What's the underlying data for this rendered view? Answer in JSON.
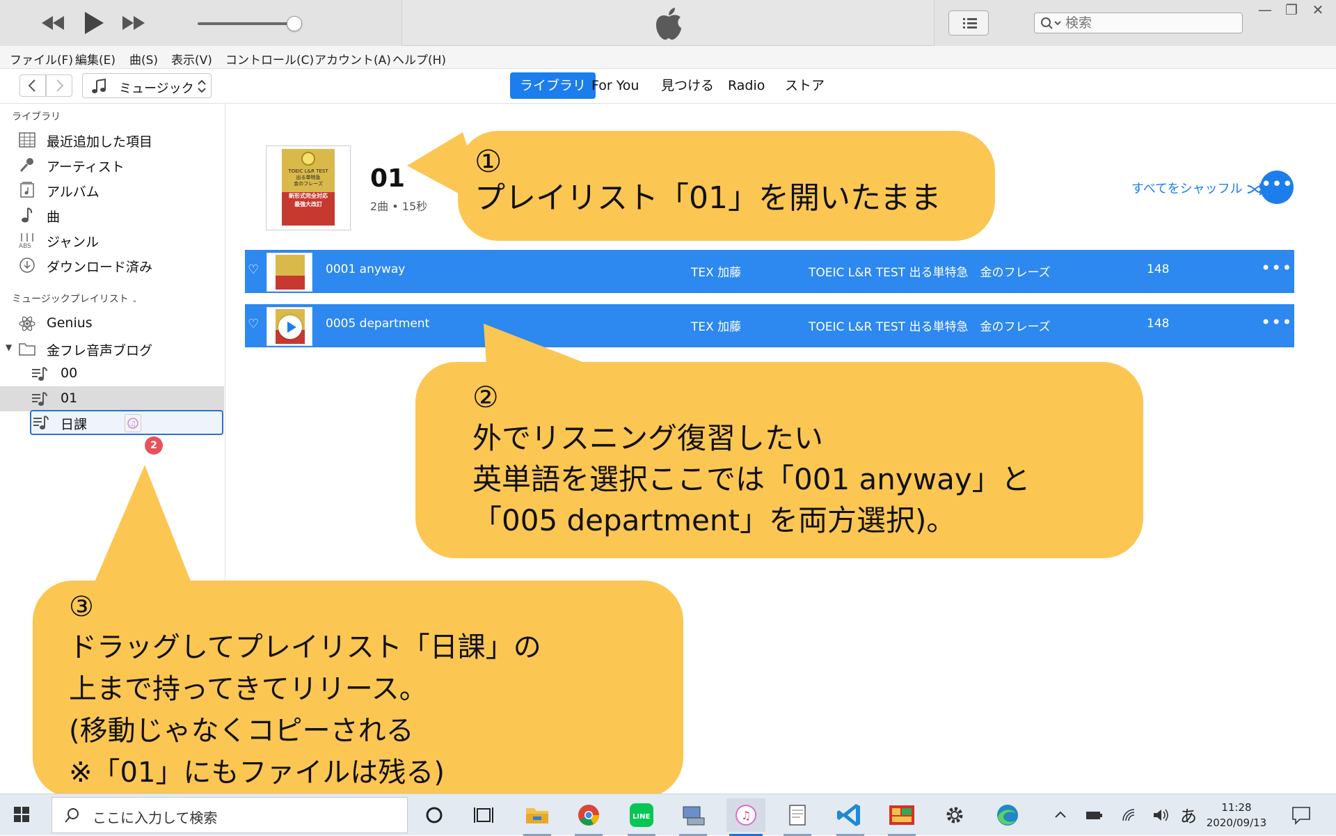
{
  "window": {
    "search_placeholder": "検索",
    "apple_logo": "apple-logo",
    "minimize": "—",
    "restore": "❐",
    "close": "✕"
  },
  "menu": {
    "items": [
      "ファイル(F)",
      "編集(E)",
      "曲(S)",
      "表示(V)",
      "コントロール(C)",
      "アカウント(A)",
      "ヘルプ(H)"
    ]
  },
  "nav": {
    "media_kind": "ミュージック",
    "tabs": [
      {
        "label": "ライブラリ",
        "active": true
      },
      {
        "label": "For You",
        "active": false
      },
      {
        "label": "見つける",
        "active": false
      },
      {
        "label": "Radio",
        "active": false
      },
      {
        "label": "ストア",
        "active": false
      }
    ]
  },
  "sidebar": {
    "library_heading": "ライブラリ",
    "library_items": [
      {
        "label": "最近追加した項目",
        "icon": "grid-calendar-icon"
      },
      {
        "label": "アーティスト",
        "icon": "microphone-icon"
      },
      {
        "label": "アルバム",
        "icon": "album-icon"
      },
      {
        "label": "曲",
        "icon": "music-note-icon"
      },
      {
        "label": "ジャンル",
        "icon": "genre-icon"
      },
      {
        "label": "ダウンロード済み",
        "icon": "download-icon"
      }
    ],
    "playlists_heading": "ミュージックプレイリスト",
    "genius": "Genius",
    "folder": "金フレ音声ブログ",
    "playlists": [
      "00",
      "01",
      "日課"
    ],
    "selected_playlist": "01",
    "drop_target": "日課",
    "drag_count": "2"
  },
  "playlist": {
    "title": "01",
    "meta": "2曲 • 15秒",
    "shuffle_label": "すべてをシャッフル",
    "more": "•••",
    "cover_lines": [
      "TOEIC L&R TEST",
      "出る単特急",
      "金のフレーズ",
      "新形式完全対応",
      "最強大改訂"
    ]
  },
  "tracks": [
    {
      "title": "0001 anyway",
      "artist": "TEX 加藤",
      "album": "TOEIC L&R TEST 出る単特急　金のフレーズ",
      "count": "148",
      "heart": "♡",
      "more": "•••"
    },
    {
      "title": "0005 department",
      "artist": "TEX 加藤",
      "album": "TOEIC L&R TEST 出る単特急　金のフレーズ",
      "count": "148",
      "heart": "♡",
      "more": "•••"
    }
  ],
  "callouts": [
    {
      "number": "①",
      "text": "プレイリスト「01」を開いたまま"
    },
    {
      "number": "②",
      "text": "外でリスニング復習したい\n英単語を選択ここでは「001 anyway」と\n「005 department」を両方選択)。"
    },
    {
      "number": "③",
      "text": "ドラッグしてプレイリスト「日課」の\n上まで持ってきてリリース。\n(移動じゃなくコピーされる\n※「01」にもファイルは残る)"
    }
  ],
  "taskbar": {
    "search_placeholder": "ここに入力して検索",
    "ime": "あ",
    "time": "11:28",
    "date": "2020/09/13",
    "line_label": "LINE"
  },
  "colors": {
    "accent": "#1c7ded",
    "selection": "#2d88ef",
    "callout": "#fcc653",
    "badge": "#e8525a"
  }
}
